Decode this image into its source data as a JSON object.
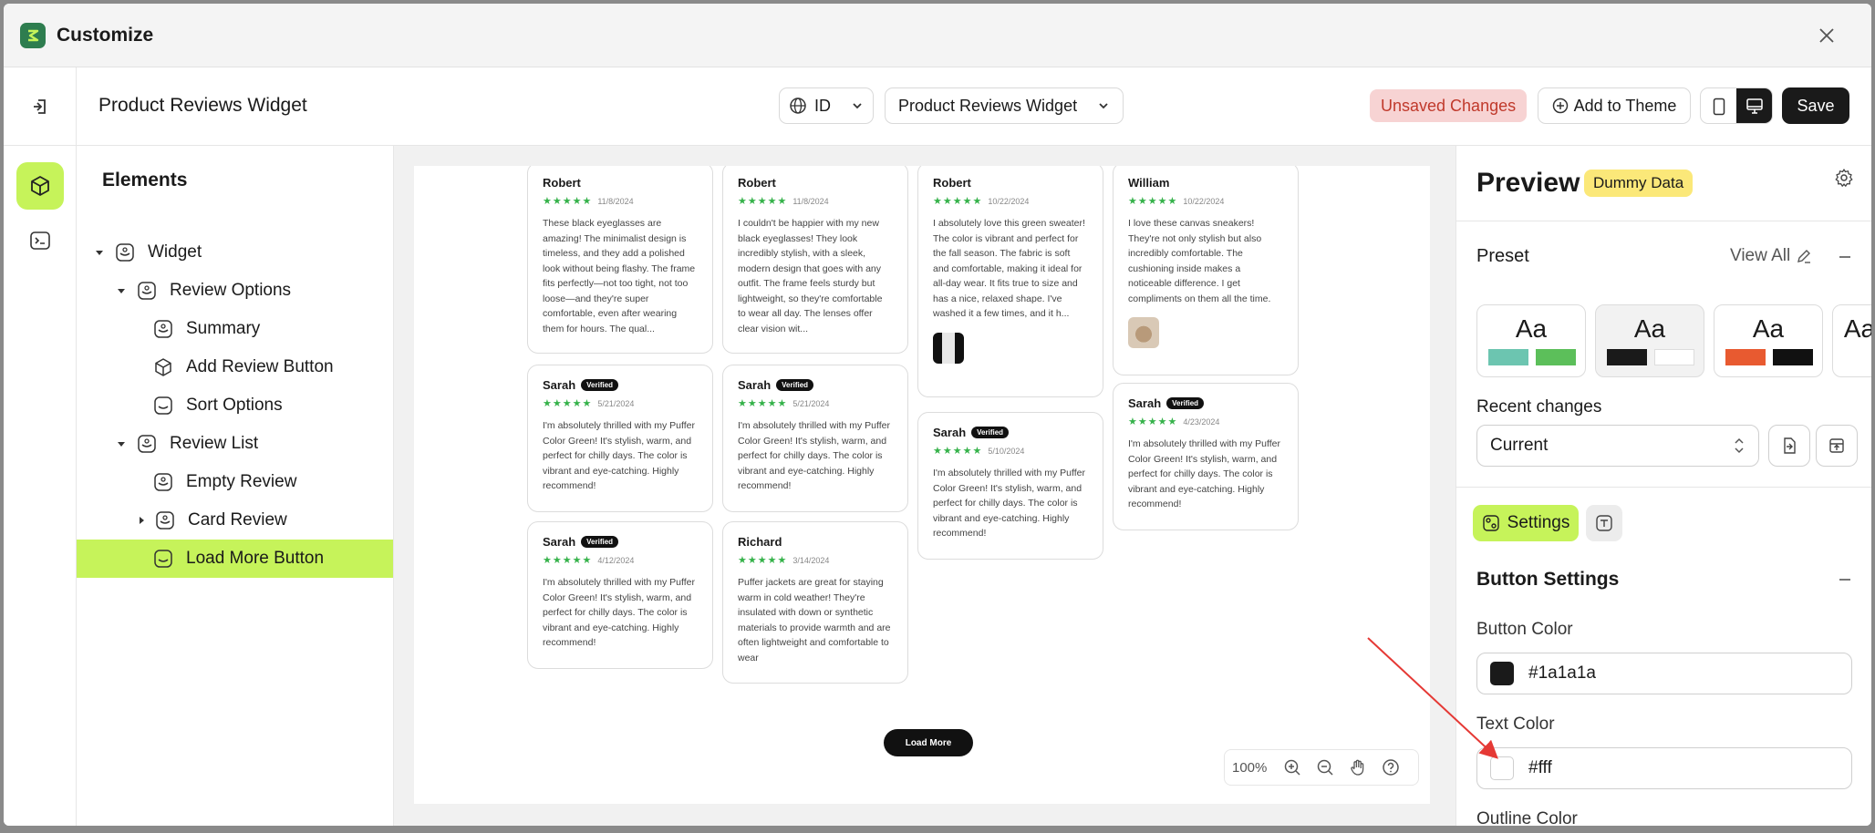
{
  "app": {
    "title": "Customize"
  },
  "toolbar": {
    "title": "Product Reviews Widget",
    "language": "ID",
    "widget_select": "Product Reviews Widget",
    "unsaved": "Unsaved Changes",
    "add_to_theme": "Add to Theme",
    "save": "Save"
  },
  "elements": {
    "title": "Elements",
    "tree": [
      {
        "label": "Widget"
      },
      {
        "label": "Review Options"
      },
      {
        "label": "Summary"
      },
      {
        "label": "Add Review Button"
      },
      {
        "label": "Sort Options"
      },
      {
        "label": "Review List"
      },
      {
        "label": "Empty Review"
      },
      {
        "label": "Card Review"
      },
      {
        "label": "Load More Button"
      }
    ]
  },
  "canvas": {
    "cards": [
      {
        "name": "Robert",
        "date": "11/8/2024",
        "verified": false,
        "text": "These black eyeglasses are amazing! The minimalist design is timeless, and they add a polished look without being flashy. The frame fits perfectly—not too tight, not too loose—and they're super comfortable, even after wearing them for hours. The qual..."
      },
      {
        "name": "Robert",
        "date": "11/8/2024",
        "verified": false,
        "text": "I couldn't be happier with my new black eyeglasses! They look incredibly stylish, with a sleek, modern design that goes with any outfit. The frame feels sturdy but lightweight, so they're comfortable to wear all day. The lenses offer clear vision wit..."
      },
      {
        "name": "Robert",
        "date": "10/22/2024",
        "verified": false,
        "text": "I absolutely love this green sweater! The color is vibrant and perfect for the fall season. The fabric is soft and comfortable, making it ideal for all-day wear. It fits true to size and has a nice, relaxed shape. I've washed it a few times, and it h..."
      },
      {
        "name": "William",
        "date": "10/22/2024",
        "verified": false,
        "text": "I love these canvas sneakers! They're not only stylish but also incredibly comfortable. The cushioning inside makes a noticeable difference. I get compliments on them all the time."
      },
      {
        "name": "Sarah",
        "date": "5/21/2024",
        "verified": true,
        "text": "I'm absolutely thrilled with my Puffer Color Green! It's stylish, warm, and perfect for chilly days. The color is vibrant and eye-catching. Highly recommend!"
      },
      {
        "name": "Sarah",
        "date": "5/21/2024",
        "verified": true,
        "text": "I'm absolutely thrilled with my Puffer Color Green! It's stylish, warm, and perfect for chilly days. The color is vibrant and eye-catching. Highly recommend!"
      },
      {
        "name": "Sarah",
        "date": "5/10/2024",
        "verified": true,
        "text": "I'm absolutely thrilled with my Puffer Color Green! It's stylish, warm, and perfect for chilly days. The color is vibrant and eye-catching. Highly recommend!"
      },
      {
        "name": "Sarah",
        "date": "4/23/2024",
        "verified": true,
        "text": "I'm absolutely thrilled with my Puffer Color Green! It's stylish, warm, and perfect for chilly days. The color is vibrant and eye-catching. Highly recommend!"
      },
      {
        "name": "Sarah",
        "date": "4/12/2024",
        "verified": true,
        "text": "I'm absolutely thrilled with my Puffer Color Green! It's stylish, warm, and perfect for chilly days. The color is vibrant and eye-catching. Highly recommend!"
      },
      {
        "name": "Richard",
        "date": "3/14/2024",
        "verified": false,
        "text": "Puffer jackets are great for staying warm in cold weather! They're insulated with down or synthetic materials to provide warmth and are often lightweight and comfortable to wear"
      }
    ],
    "stars": "★★★★★",
    "verified_label": "Verified",
    "load_more": "Load More",
    "zoom": "100%"
  },
  "preview": {
    "title": "Preview",
    "badge": "Dummy Data",
    "preset_label": "Preset",
    "view_all": "View All",
    "preset_sample": "Aa",
    "presets": [
      {
        "colors": [
          "#6cc5b0",
          "#5cbf5a"
        ]
      },
      {
        "colors": [
          "#1a1a1a",
          "#ffffff"
        ]
      },
      {
        "colors": [
          "#e85a30",
          "#111111"
        ]
      }
    ],
    "recent_label": "Recent changes",
    "recent_value": "Current",
    "settings_tab": "Settings",
    "group_title": "Button Settings",
    "button_color_label": "Button Color",
    "button_color": "#1a1a1a",
    "text_color_label": "Text Color",
    "text_color": "#fff",
    "outline_color_label": "Outline Color"
  },
  "colors": {
    "accent": "#c6f35a",
    "star": "#35b24a",
    "unsaved_bg": "#f7d3d3",
    "unsaved_text": "#c0392b",
    "badge": "#fbe879",
    "annotation": "#e53935"
  }
}
